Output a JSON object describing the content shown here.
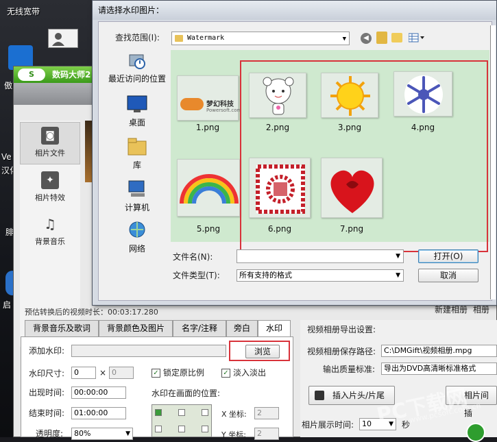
{
  "desktop": {
    "top_label": "无线宽带",
    "left_fragments": [
      "傲",
      "Ve",
      "汉化",
      "腓",
      "启"
    ]
  },
  "app": {
    "title": "数码大师2",
    "logo_text": "S",
    "sidebar": [
      {
        "label": "相片文件",
        "icon": "camera-icon"
      },
      {
        "label": "相片特效",
        "icon": "effects-icon"
      },
      {
        "label": "背景音乐",
        "icon": "music-note-icon"
      }
    ],
    "status_text": "预估转换后的视频时长：00:03:17.280",
    "new_album_label": "新建相册",
    "album_fragment": "相册",
    "tabs": [
      "背景音乐及歌词",
      "背景颜色及图片",
      "名字/注释",
      "旁白",
      "水印"
    ],
    "active_tab": "水印",
    "watermark_panel": {
      "add_label": "添加水印:",
      "browse_label": "浏览",
      "size_label": "水印尺寸:",
      "width_value": "0",
      "times": "×",
      "height_value": "0",
      "lock_ratio_label": "锁定原比例",
      "fade_label": "淡入淡出",
      "appear_label": "出现时间:",
      "appear_value": "00:00:00",
      "end_label": "结束时间:",
      "end_value": "01:00:00",
      "opacity_label": "透明度:",
      "opacity_value": "80%",
      "position_label": "水印在画面的位置:",
      "x_label": "X 坐标:",
      "x_value": "2",
      "y_label": "Y 坐标:",
      "y_value": "2"
    },
    "export": {
      "header": "视频相册导出设置:",
      "path_label": "视频相册保存路径:",
      "path_value": "C:\\DMGift\\视频相册.mpg",
      "quality_label": "输出质量标准:",
      "quality_value": "导出为DVD高清晰标准格式",
      "insert_btn": "插入片头/片尾",
      "photo_btn_fragment": "相片间插",
      "display_time_label": "相片展示时间:",
      "display_time_value": "10",
      "unit": "秒"
    },
    "site_watermark": "PC下载网",
    "site_url": "www.pcsoft.com.cn"
  },
  "dialog": {
    "title": "请选择水印图片：",
    "lookin_label": "查找范围(I):",
    "folder": "Watermark",
    "places": [
      {
        "label": "最近访问的位置",
        "icon": "recent-places-icon"
      },
      {
        "label": "桌面",
        "icon": "desktop-icon"
      },
      {
        "label": "库",
        "icon": "library-icon"
      },
      {
        "label": "计算机",
        "icon": "computer-icon"
      },
      {
        "label": "网络",
        "icon": "network-icon"
      }
    ],
    "files": [
      {
        "name": "1.png",
        "thumb_text": "梦幻科技",
        "thumb_sub": "Powersoft.com"
      },
      {
        "name": "2.png"
      },
      {
        "name": "3.png"
      },
      {
        "name": "4.png"
      },
      {
        "name": "5.png"
      },
      {
        "name": "6.png"
      },
      {
        "name": "7.png"
      }
    ],
    "filename_label": "文件名(N):",
    "filename_value": "",
    "filetype_label": "文件类型(T):",
    "filetype_value": "所有支持的格式",
    "open_btn": "打开(O)",
    "cancel_btn": "取消"
  },
  "colors": {
    "highlight_box": "#d8323a",
    "file_area_bg": "#cfe9cf",
    "app_title_green": "#3a9a1a"
  }
}
